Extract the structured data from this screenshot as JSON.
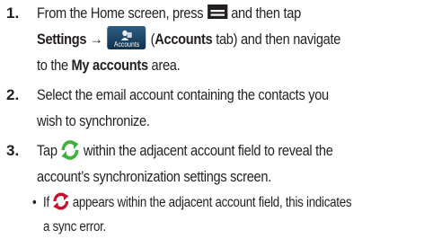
{
  "steps": [
    {
      "number": "1.",
      "parts": {
        "a": "From the Home screen, press",
        "b": "and then tap",
        "settings": "Settings",
        "arrow": "→",
        "accounts_icon_label": "Accounts",
        "open_paren": "(",
        "accounts_tab": "Accounts",
        "tab_rest": "tab) and then navigate",
        "to_the": "to the",
        "my_accounts": "My accounts",
        "area": "area."
      },
      "icons": [
        "menu-icon",
        "accounts-settings-icon"
      ]
    },
    {
      "number": "2.",
      "lines": [
        "Select the email account containing the contacts you",
        "wish to synchronize."
      ]
    },
    {
      "number": "3.",
      "parts": {
        "tap": "Tap",
        "rest": "within the adjacent account field to reveal the",
        "line2": "account’s synchronization settings screen."
      },
      "icons": [
        "sync-icon"
      ],
      "bullet": {
        "mark": "•",
        "if": "If",
        "rest": "appears within the adjacent account field, this indicates",
        "line2": "a sync error.",
        "icon": "sync-error-icon"
      }
    }
  ],
  "colors": {
    "text": "#231f20",
    "sync_green": "#3cb23c",
    "sync_error_red": "#c8102e",
    "accounts_icon_bg": "#1f4a6e"
  }
}
